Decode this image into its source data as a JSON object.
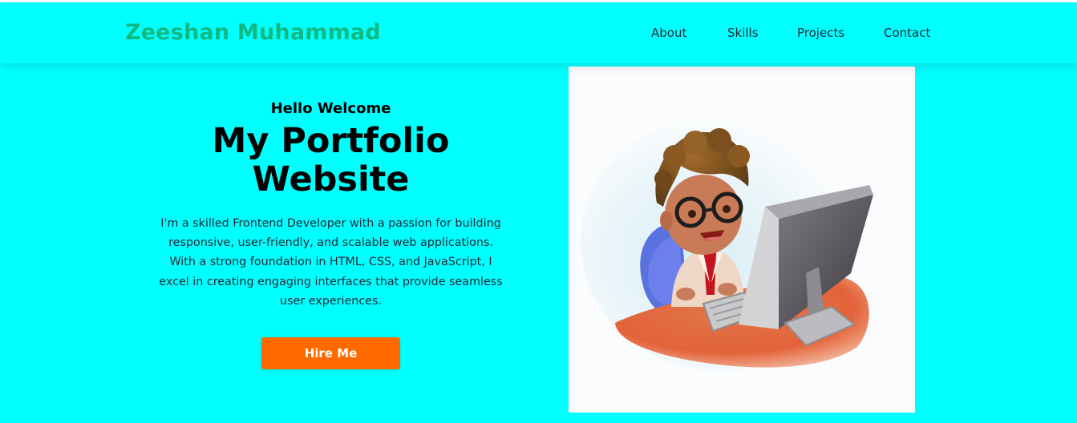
{
  "nav": {
    "brand": "Zeeshan Muhammad",
    "links": [
      "About",
      "Skills",
      "Projects",
      "Contact"
    ]
  },
  "hero": {
    "greeting": "Hello Welcome",
    "title_line1": "My Portfolio",
    "title_line2": "Website",
    "description": "I'm a skilled Frontend Developer with a passion for building responsive, user-friendly, and scalable web applications. With a strong foundation in HTML, CSS, and JavaScript, I excel in creating engaging interfaces that provide seamless user experiences.",
    "button_label": "Hire Me"
  },
  "colors": {
    "background": "#00ffff",
    "brand": "#10b981",
    "button": "#ff6a00"
  },
  "icons": [
    "developer-illustration"
  ]
}
